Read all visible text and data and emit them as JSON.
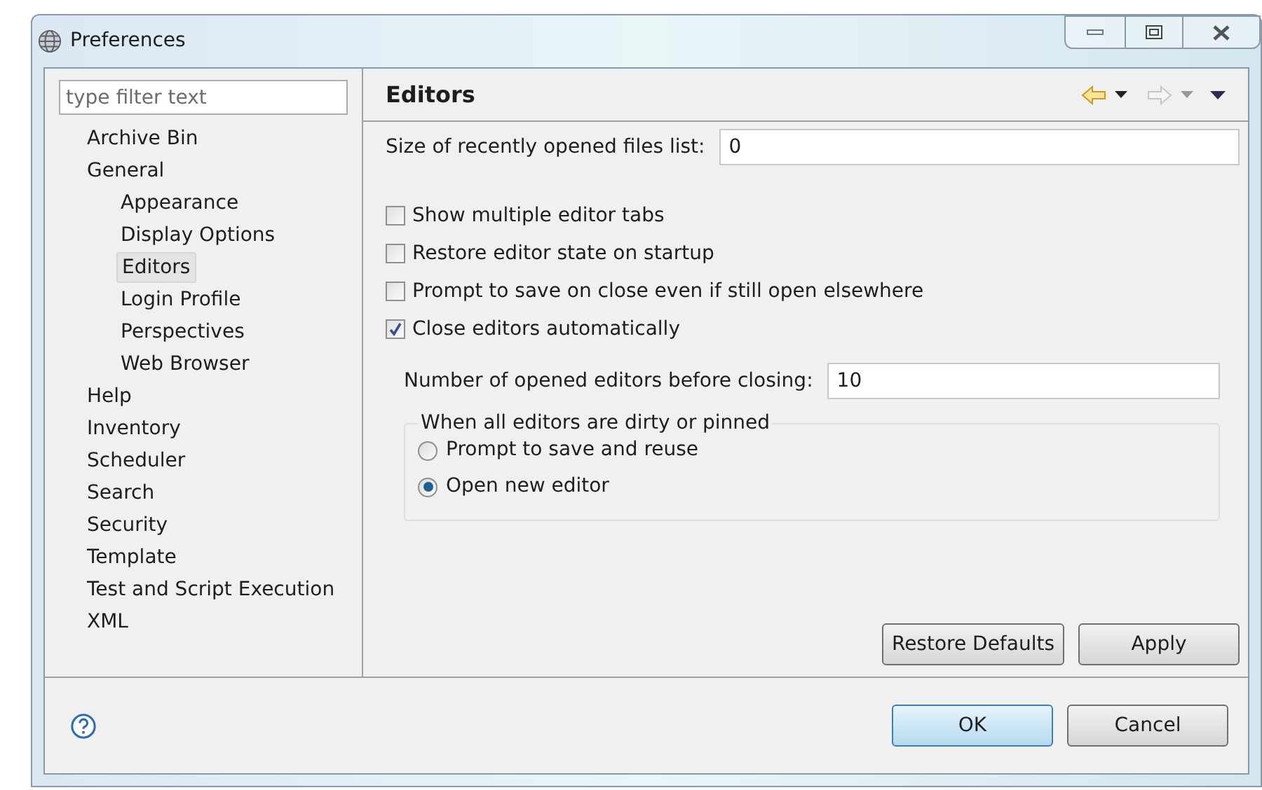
{
  "window": {
    "title": "Preferences"
  },
  "filter": {
    "placeholder": "type filter text"
  },
  "tree": [
    {
      "label": "Archive Bin",
      "selected": false
    },
    {
      "label": "General",
      "selected": false,
      "children": [
        {
          "label": "Appearance",
          "selected": false
        },
        {
          "label": "Display Options",
          "selected": false
        },
        {
          "label": "Editors",
          "selected": true
        },
        {
          "label": "Login Profile",
          "selected": false
        },
        {
          "label": "Perspectives",
          "selected": false
        },
        {
          "label": "Web Browser",
          "selected": false
        }
      ]
    },
    {
      "label": "Help",
      "selected": false
    },
    {
      "label": "Inventory",
      "selected": false
    },
    {
      "label": "Scheduler",
      "selected": false
    },
    {
      "label": "Search",
      "selected": false
    },
    {
      "label": "Security",
      "selected": false
    },
    {
      "label": "Template",
      "selected": false
    },
    {
      "label": "Test and Script Execution",
      "selected": false
    },
    {
      "label": "XML",
      "selected": false
    }
  ],
  "page": {
    "title": "Editors",
    "recent_files": {
      "label": "Size of recently opened files list:",
      "value": "0"
    },
    "checkboxes": [
      {
        "label": "Show multiple editor tabs",
        "checked": false
      },
      {
        "label": "Restore editor state on startup",
        "checked": false
      },
      {
        "label": "Prompt to save on close even if still open elsewhere",
        "checked": false
      },
      {
        "label": "Close editors automatically",
        "checked": true
      }
    ],
    "editors_before_closing": {
      "label": "Number of opened editors before closing:",
      "value": "10"
    },
    "group": {
      "title": "When all editors are dirty or pinned",
      "options": [
        {
          "label": "Prompt to save and reuse",
          "selected": false
        },
        {
          "label": "Open new editor",
          "selected": true
        }
      ]
    },
    "buttons": [
      "Restore Defaults",
      "Apply"
    ]
  },
  "footer": {
    "buttons": [
      {
        "label": "OK",
        "default": true
      },
      {
        "label": "Cancel",
        "default": false
      }
    ]
  }
}
